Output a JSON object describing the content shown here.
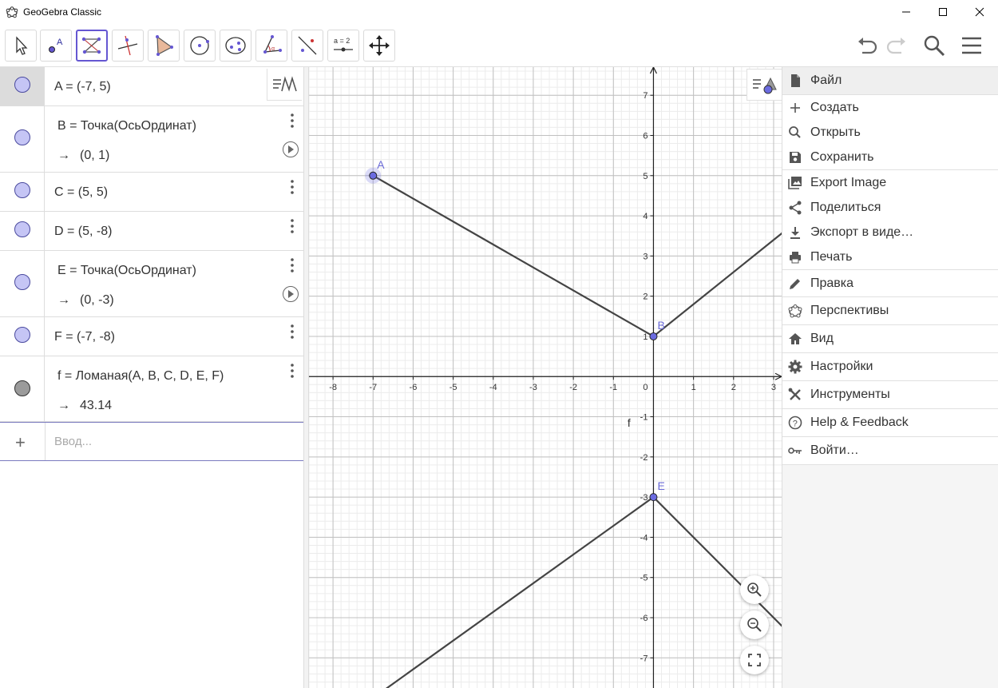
{
  "window": {
    "title": "GeoGebra Classic"
  },
  "toolbar": {
    "tools": [
      {
        "name": "move-tool",
        "label": ""
      },
      {
        "name": "point-tool",
        "label": ""
      },
      {
        "name": "polyline-tool",
        "label": ""
      },
      {
        "name": "perpendicular-line-tool",
        "label": ""
      },
      {
        "name": "polygon-tool",
        "label": ""
      },
      {
        "name": "circle-center-point-tool",
        "label": ""
      },
      {
        "name": "ellipse-tool",
        "label": ""
      },
      {
        "name": "angle-tool",
        "label": ""
      },
      {
        "name": "reflect-tool",
        "label": ""
      },
      {
        "name": "slider-tool",
        "label": "a = 2"
      },
      {
        "name": "move-graphics-view-tool",
        "label": ""
      }
    ],
    "active_tool": "polyline-tool"
  },
  "algebra": {
    "rows": [
      {
        "name": "A",
        "definition": "A = (-7, 5)",
        "value": "",
        "selected": true,
        "color": "#c5c5f5"
      },
      {
        "name": "B",
        "definition": "B = Точка(ОсьОрдинат)",
        "value": "(0, 1)",
        "selected": false,
        "color": "#c5c5f5"
      },
      {
        "name": "C",
        "definition": "C = (5, 5)",
        "value": "",
        "selected": false,
        "color": "#c5c5f5"
      },
      {
        "name": "D",
        "definition": "D = (5, -8)",
        "value": "",
        "selected": false,
        "color": "#c5c5f5"
      },
      {
        "name": "E",
        "definition": "E = Точка(ОсьОрдинат)",
        "value": "(0, -3)",
        "selected": false,
        "color": "#c5c5f5"
      },
      {
        "name": "F",
        "definition": "F = (-7, -8)",
        "value": "",
        "selected": false,
        "color": "#c5c5f5"
      },
      {
        "name": "f",
        "definition": "f = Ломаная(A, B, C, D, E, F)",
        "value": "43.14",
        "selected": false,
        "color": "#9b9b9b"
      }
    ],
    "arrow": "→",
    "input_placeholder": "Ввод..."
  },
  "graphics": {
    "x_range": [
      -8.6,
      3.2
    ],
    "y_range": [
      -7.75,
      7.7
    ],
    "x_ticks": [
      "-8",
      "-7",
      "-6",
      "-5",
      "-4",
      "-3",
      "-2",
      "-1",
      "0",
      "1",
      "2",
      "3"
    ],
    "y_ticks": [
      "7",
      "6",
      "5",
      "4",
      "3",
      "2",
      "1",
      "-1",
      "-2",
      "-3",
      "-4",
      "-5",
      "-6",
      "-7"
    ],
    "points": [
      {
        "label": "A",
        "x": -7,
        "y": 5,
        "visible": true
      },
      {
        "label": "B",
        "x": 0,
        "y": 1,
        "visible": true
      },
      {
        "label": "E",
        "x": 0,
        "y": -3,
        "visible": true
      }
    ],
    "polyline": {
      "label": "f",
      "vertices": [
        [
          -7,
          5
        ],
        [
          0,
          1
        ],
        [
          5,
          5
        ],
        [
          5,
          -8
        ],
        [
          0,
          -3
        ],
        [
          -7,
          -8
        ]
      ]
    },
    "colors": {
      "point_fill": "#6b6be0",
      "point_label": "#6b6bd8",
      "line": "#444444",
      "grid_major": "#c0c0c0",
      "grid_minor": "#ececec"
    }
  },
  "menu": {
    "header": {
      "label": "Файл",
      "icon": "file-icon"
    },
    "file_items": [
      {
        "label": "Создать",
        "icon": "plus-icon"
      },
      {
        "label": "Открыть",
        "icon": "search-icon"
      },
      {
        "label": "Сохранить",
        "icon": "save-icon"
      },
      {
        "label": "Export Image",
        "icon": "image-icon"
      },
      {
        "label": "Поделиться",
        "icon": "share-icon"
      },
      {
        "label": "Экспорт в виде…",
        "icon": "download-icon"
      },
      {
        "label": "Печать",
        "icon": "print-icon"
      }
    ],
    "sections": [
      {
        "label": "Правка",
        "icon": "pencil-icon"
      },
      {
        "label": "Перспективы",
        "icon": "perspectives-icon"
      },
      {
        "label": "Вид",
        "icon": "home-icon"
      },
      {
        "label": "Настройки",
        "icon": "gear-icon"
      },
      {
        "label": "Инструменты",
        "icon": "tools-icon"
      },
      {
        "label": "Help & Feedback",
        "icon": "help-icon"
      },
      {
        "label": "Войти…",
        "icon": "sign-in-icon"
      }
    ]
  }
}
